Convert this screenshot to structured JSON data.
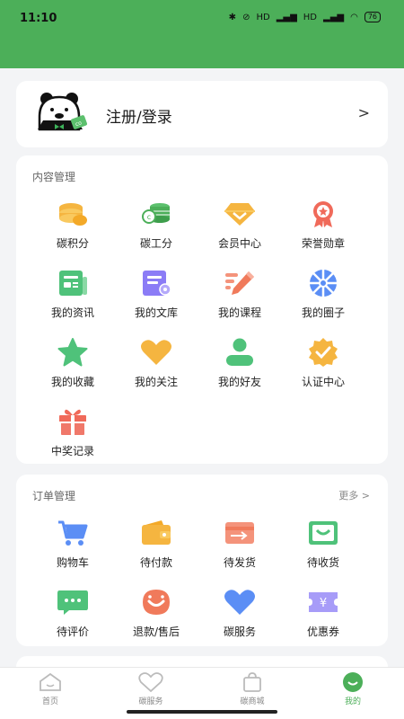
{
  "status": {
    "time": "11:10",
    "battery": "76",
    "signal1": "HD",
    "signal2": "HD"
  },
  "login": {
    "label": "注册/登录",
    "arrow": ">"
  },
  "content": {
    "title": "内容管理",
    "items": [
      {
        "label": "碳积分",
        "icon": "coins-icon"
      },
      {
        "label": "碳工分",
        "icon": "coin-stack-icon"
      },
      {
        "label": "会员中心",
        "icon": "diamond-icon"
      },
      {
        "label": "荣誉勋章",
        "icon": "medal-icon"
      },
      {
        "label": "我的资讯",
        "icon": "news-icon"
      },
      {
        "label": "我的文库",
        "icon": "library-icon"
      },
      {
        "label": "我的课程",
        "icon": "pen-icon"
      },
      {
        "label": "我的圈子",
        "icon": "aperture-icon"
      },
      {
        "label": "我的收藏",
        "icon": "star-icon"
      },
      {
        "label": "我的关注",
        "icon": "heart-icon"
      },
      {
        "label": "我的好友",
        "icon": "person-icon"
      },
      {
        "label": "认证中心",
        "icon": "badge-check-icon"
      },
      {
        "label": "中奖记录",
        "icon": "gift-icon"
      }
    ]
  },
  "orders": {
    "title": "订单管理",
    "more": "更多 >",
    "items": [
      {
        "label": "购物车",
        "icon": "cart-icon"
      },
      {
        "label": "待付款",
        "icon": "wallet-icon"
      },
      {
        "label": "待发货",
        "icon": "card-send-icon"
      },
      {
        "label": "待收货",
        "icon": "bag-icon"
      },
      {
        "label": "待评价",
        "icon": "comment-icon"
      },
      {
        "label": "退款/售后",
        "icon": "smile-icon"
      },
      {
        "label": "碳服务",
        "icon": "heart-blue-icon"
      },
      {
        "label": "优惠券",
        "icon": "coupon-icon"
      }
    ]
  },
  "tabs": [
    {
      "label": "首页",
      "icon": "home-icon"
    },
    {
      "label": "碳服务",
      "icon": "heart-outline-icon"
    },
    {
      "label": "碳商城",
      "icon": "shop-bag-icon"
    },
    {
      "label": "我的",
      "icon": "profile-icon"
    }
  ],
  "colors": {
    "brand": "#4caf59",
    "orange": "#f5b540",
    "blue": "#5b8ef5",
    "purple": "#8b7cf6",
    "red": "#f06a5a"
  }
}
